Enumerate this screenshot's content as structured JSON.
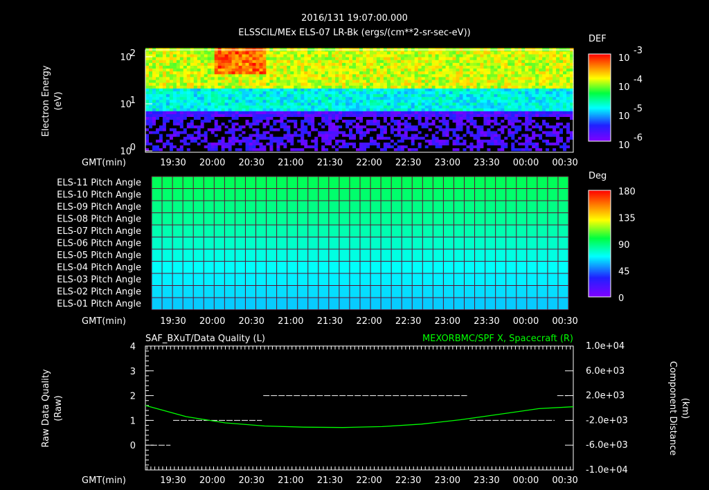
{
  "header": {
    "timestamp": "2016/131 19:07:00.000",
    "subtitle": "ELSSCIL/MEx ELS-07 LR-Bk  (ergs/(cm**2-sr-sec-eV))"
  },
  "time_axis": {
    "label": "GMT(min)",
    "ticks": [
      "19:30",
      "20:00",
      "20:30",
      "21:00",
      "21:30",
      "22:00",
      "22:30",
      "23:00",
      "23:30",
      "00:00",
      "00:30"
    ],
    "tick_minutes": [
      30,
      60,
      90,
      120,
      150,
      180,
      210,
      240,
      270,
      300,
      330
    ],
    "start_minute": 7,
    "end_minute": 337
  },
  "chart_data": [
    {
      "type": "heatmap",
      "title": "ELSSCIL/MEx ELS-07 LR-Bk  (ergs/(cm**2-sr-sec-eV))",
      "ylabel": "Electron Energy (eV)",
      "yticks": [
        "10",
        "10",
        "10"
      ],
      "ytick_exps": [
        "0",
        "1",
        "2"
      ],
      "ylim": [
        1,
        150
      ],
      "yscale": "log",
      "colorbar": {
        "label": "DEF",
        "ticks": [
          "10",
          "10",
          "10",
          "10"
        ],
        "tick_exps": [
          "-3",
          "-4",
          "-5",
          "-6"
        ],
        "range": [
          1e-06,
          0.001
        ],
        "scale": "log"
      },
      "description_bands": [
        {
          "energy_range_eV": [
            20,
            150
          ],
          "level": 0.00012
        },
        {
          "energy_range_eV": [
            7,
            20
          ],
          "level": 1.5e-05
        },
        {
          "energy_range_eV": [
            1,
            7
          ],
          "level": 2e-06
        }
      ],
      "hot_region": {
        "time_range": [
          "20:05",
          "20:45"
        ],
        "energy_range_eV": [
          40,
          120
        ],
        "level": 0.0005
      }
    },
    {
      "type": "heatmap",
      "rows": [
        "ELS-11 Pitch Angle",
        "ELS-10 Pitch Angle",
        "ELS-09 Pitch Angle",
        "ELS-08 Pitch Angle",
        "ELS-07 Pitch Angle",
        "ELS-06 Pitch Angle",
        "ELS-05 Pitch Angle",
        "ELS-04 Pitch Angle",
        "ELS-03 Pitch Angle",
        "ELS-02 Pitch Angle",
        "ELS-01 Pitch Angle"
      ],
      "row_values_deg": [
        95,
        92,
        88,
        85,
        81,
        77,
        73,
        69,
        66,
        63,
        60
      ],
      "colorbar": {
        "label": "Deg",
        "ticks": [
          "180",
          "135",
          "90",
          "45",
          "0"
        ],
        "range": [
          0,
          180
        ]
      }
    },
    {
      "type": "line",
      "title_left": "SAF_BXuT/Data Quality (L)",
      "title_right": "MEXORBMC/SPF X, Spacecraft (R)",
      "ylabel_left": "Raw Data Quality (Raw)",
      "ylabel_right": "Component Distance (km)",
      "ylim_left": [
        -1,
        4
      ],
      "yticks_left": [
        "4",
        "3",
        "2",
        "1",
        "0"
      ],
      "ylim_right": [
        -10000,
        10000
      ],
      "yticks_right": [
        "1.0e+04",
        "6.0e+03",
        "2.0e+03",
        "-2.0e+03",
        "-6.0e+03",
        "-1.0e+04"
      ],
      "series": [
        {
          "name": "Data Quality",
          "axis": "left",
          "color": "#ffffff",
          "segments": [
            {
              "from": 13,
              "to": 28,
              "value": 0
            },
            {
              "from": 30,
              "to": 98,
              "value": 1
            },
            {
              "from": 99,
              "to": 255,
              "value": 2
            },
            {
              "from": 257,
              "to": 322,
              "value": 1
            },
            {
              "from": 324,
              "to": 332,
              "value": 2
            }
          ]
        },
        {
          "name": "MEXORBMC/SPF X",
          "axis": "right",
          "color": "#00ff00",
          "x": [
            7,
            40,
            70,
            100,
            130,
            160,
            190,
            220,
            250,
            280,
            310,
            337
          ],
          "y": [
            400,
            -1400,
            -2400,
            -2900,
            -3100,
            -3150,
            -3000,
            -2600,
            -1900,
            -1000,
            -100,
            200
          ]
        }
      ]
    }
  ],
  "colors": {
    "accent_green": "#00ff00",
    "grid": "#6a1a3a"
  }
}
